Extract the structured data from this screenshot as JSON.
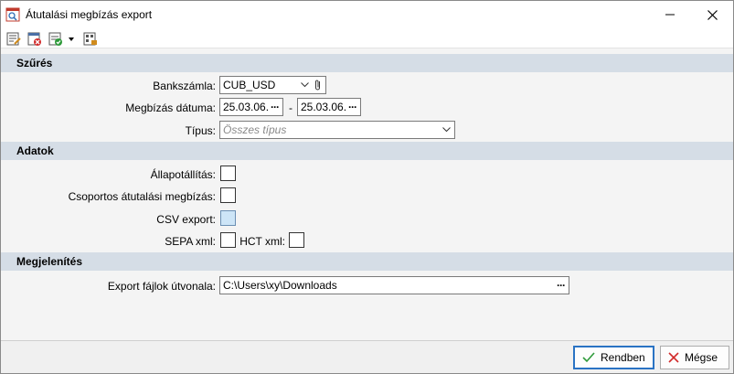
{
  "window": {
    "title": "Átutalási megbízás export"
  },
  "toolbar": {
    "buttons": [
      "edit-icon",
      "delete-icon",
      "schedule-icon",
      "dropdown-arrow-icon",
      "export-icon"
    ]
  },
  "sections": {
    "filter": {
      "title": "Szűrés"
    },
    "data": {
      "title": "Adatok"
    },
    "display": {
      "title": "Megjelenítés"
    }
  },
  "filter": {
    "bank_account_label": "Bankszámla:",
    "bank_account_value": "CUB_USD",
    "date_label": "Megbízás dátuma:",
    "date_from": "25.03.06.",
    "date_sep": "-",
    "date_to": "25.03.06.",
    "type_label": "Típus:",
    "type_placeholder": "Összes típus"
  },
  "data": {
    "status_label": "Állapotállítás:",
    "group_label": "Csoportos átutalási megbízás:",
    "csv_label": "CSV export:",
    "sepa_label": "SEPA xml:",
    "hct_label": "HCT xml:"
  },
  "display": {
    "path_label": "Export fájlok útvonala:",
    "path_value": "C:\\Users\\xy\\Downloads"
  },
  "footer": {
    "ok_label": "Rendben",
    "cancel_label": "Mégse"
  },
  "colors": {
    "section_header": "#d5dde6",
    "primary_border": "#2a73c4",
    "ok_check": "#2e9a3a",
    "cancel_x": "#d12a2a"
  }
}
